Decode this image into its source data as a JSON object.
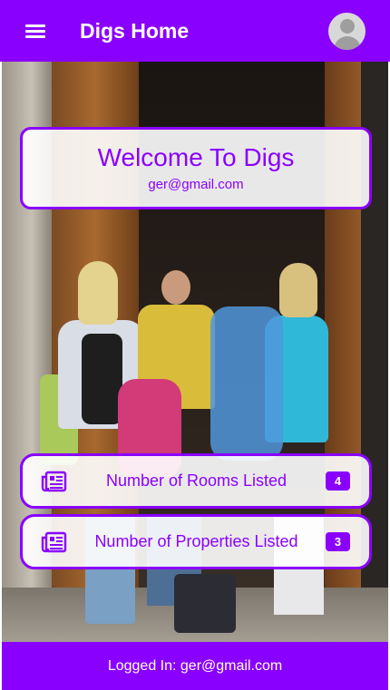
{
  "header": {
    "title": "Digs Home",
    "menu_icon": "hamburger-menu-icon",
    "avatar_icon": "account-avatar-icon"
  },
  "welcome": {
    "title": "Welcome To Digs",
    "email": "ger@gmail.com"
  },
  "stats": [
    {
      "label": "Number of Rooms Listed",
      "count": "4",
      "icon": "newspaper-icon"
    },
    {
      "label": "Number of Properties Listed",
      "count": "3",
      "icon": "newspaper-icon"
    }
  ],
  "footer": {
    "text": "Logged In: ger@gmail.com"
  },
  "colors": {
    "primary": "#8a00ff",
    "card_background": "#ffffff",
    "text_on_primary": "#ffffff"
  }
}
